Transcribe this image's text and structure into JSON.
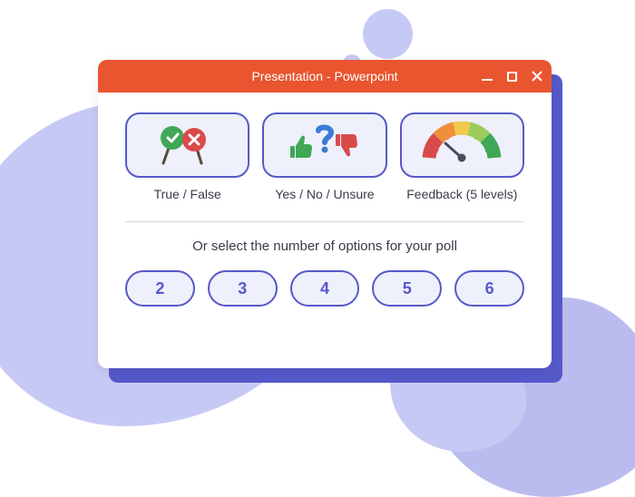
{
  "window": {
    "title": "Presentation - Powerpoint"
  },
  "poll_types": {
    "true_false": {
      "label": "True / False"
    },
    "yes_no_unsure": {
      "label": "Yes / No / Unsure"
    },
    "feedback": {
      "label": "Feedback (5 levels)"
    }
  },
  "subtitle": "Or select the number of options for your poll",
  "num_options": {
    "n2": "2",
    "n3": "3",
    "n4": "4",
    "n5": "5",
    "n6": "6"
  }
}
